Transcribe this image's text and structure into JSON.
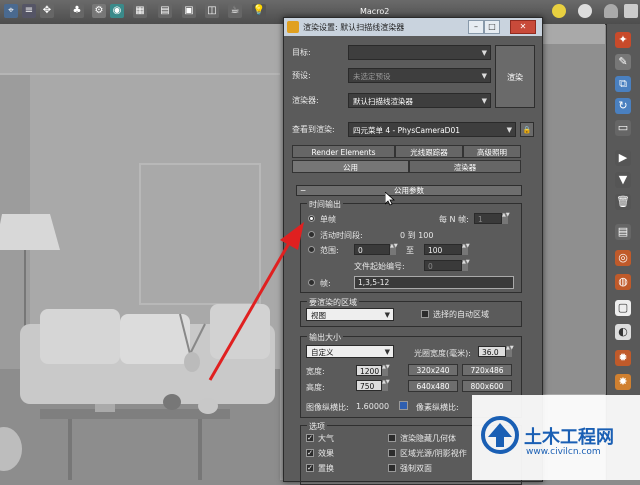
{
  "toolbar": {
    "macro_label": "Macro2"
  },
  "dialog": {
    "title": "渲染设置: 默认扫描线渲染器",
    "target_label": "目标:",
    "target_value": "",
    "preset_label": "预设:",
    "preset_value": "未选定预设",
    "renderer_label": "渲染器:",
    "renderer_value": "默认扫描线渲染器",
    "view_label": "查看到渲染:",
    "view_value": "四元菜单 4 - PhysCameraD01",
    "render_button": "渲染",
    "lock_icon": "lock-icon",
    "tabs_row1": [
      "Render Elements",
      "光线跟踪器",
      "高级照明"
    ],
    "tabs_row2": [
      "公用",
      "渲染器"
    ],
    "rollout_title": "公用参数",
    "time_output": {
      "title": "时间输出",
      "single": "单帧",
      "every_n_label": "每 N 帧:",
      "every_n_value": "1",
      "active_segment": "活动时间段:",
      "active_range": "0 到 100",
      "range_label": "范围:",
      "range_from": "0",
      "range_to_label": "至",
      "range_to": "100",
      "file_start_label": "文件起始编号:",
      "file_start_value": "0",
      "frames_label": "帧:",
      "frames_value": "1,3,5-12"
    },
    "area": {
      "title": "要渲染的区域",
      "value": "视图",
      "auto_region": "选择的自动区域"
    },
    "output_size": {
      "title": "输出大小",
      "preset": "自定义",
      "aperture_label": "光圈宽度(毫米):",
      "aperture_value": "36.0",
      "width_label": "宽度:",
      "width_value": "1200",
      "height_label": "高度:",
      "height_value": "750",
      "presets": [
        "320x240",
        "720x486",
        "640x480",
        "800x600"
      ],
      "image_aspect_label": "图像纵横比:",
      "image_aspect_value": "1.60000",
      "pixel_aspect_label": "像素纵横比:"
    },
    "options": {
      "title": "选项",
      "items_left": [
        "大气",
        "效果",
        "置换"
      ],
      "items_right": [
        "渲染隐藏几何体",
        "区域光源/阴影视作",
        "强制双面"
      ]
    }
  },
  "watermark": {
    "name": "土木工程网",
    "url": "www.civilcn.com"
  },
  "colors": {
    "arrow": "#e02020",
    "dialog_bg": "#5b5b5b",
    "titlebar": "#c9d3de",
    "logo_blue": "#1a5fb4"
  }
}
